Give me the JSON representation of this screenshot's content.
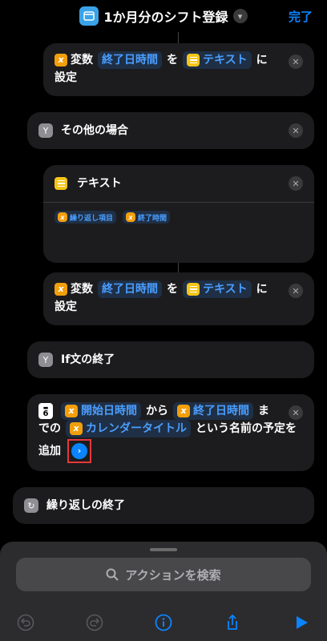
{
  "header": {
    "title": "1か月分のシフト登録",
    "done_label": "完了"
  },
  "actions": {
    "set_var_1": {
      "prefix": "変数",
      "var_name": "終了日時間",
      "particle": "を",
      "value": "テキスト",
      "suffix": "に",
      "line2": "設定"
    },
    "otherwise": {
      "label": "その他の場合"
    },
    "text_block": {
      "label": "テキスト",
      "tokens": [
        "繰り返し項目",
        "終了時間"
      ]
    },
    "set_var_2": {
      "prefix": "変数",
      "var_name": "終了日時間",
      "particle": "を",
      "value": "テキスト",
      "suffix": "に",
      "line2": "設定"
    },
    "end_if": {
      "label": "If文の終了"
    },
    "add_event": {
      "start_token": "開始日時間",
      "from": "から",
      "end_token": "終了日時間",
      "until_1": "ま",
      "until_2": "での",
      "title_token": "カレンダータイトル",
      "desc": "という名前の予定を",
      "add": "追加",
      "cal_day": "6"
    },
    "end_repeat": {
      "label": "繰り返しの終了"
    }
  },
  "bottom": {
    "search_placeholder": "アクションを検索"
  },
  "colors": {
    "accent": "#0a84ff",
    "variable": "#f29f0c",
    "highlight": "#e5383b"
  }
}
